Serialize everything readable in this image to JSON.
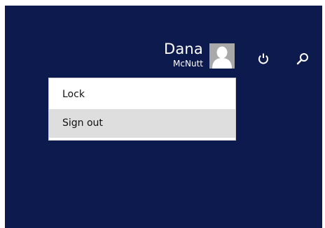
{
  "colors": {
    "background": "#0d1a4e",
    "menu_background": "#ffffff",
    "menu_hover": "#dedede",
    "avatar_background": "#a9a9a9"
  },
  "user": {
    "first_name": "Dana",
    "last_name": "McNutt",
    "avatar_icon": "person-silhouette-icon"
  },
  "charms": {
    "power_icon": "power-icon",
    "search_icon": "search-icon"
  },
  "account_menu": {
    "items": [
      {
        "label": "Lock"
      },
      {
        "label": "Sign out",
        "highlighted": true
      }
    ]
  }
}
